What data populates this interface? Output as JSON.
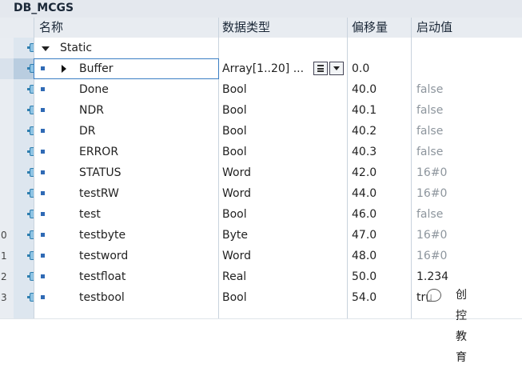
{
  "title": "DB_MCGS",
  "columns": {
    "name": "名称",
    "type": "数据类型",
    "offset": "偏移量",
    "start": "启动值"
  },
  "static_row": {
    "name": "Static"
  },
  "rows": [
    {
      "num": "",
      "name": "Buffer",
      "type": "Array[1..20] ...",
      "offset": "0.0",
      "start": "",
      "expand": true,
      "selected": true
    },
    {
      "num": "",
      "name": "Done",
      "type": "Bool",
      "offset": "40.0",
      "start": "false"
    },
    {
      "num": "",
      "name": "NDR",
      "type": "Bool",
      "offset": "40.1",
      "start": "false"
    },
    {
      "num": "",
      "name": "DR",
      "type": "Bool",
      "offset": "40.2",
      "start": "false"
    },
    {
      "num": "",
      "name": "ERROR",
      "type": "Bool",
      "offset": "40.3",
      "start": "false"
    },
    {
      "num": "",
      "name": "STATUS",
      "type": "Word",
      "offset": "42.0",
      "start": "16#0"
    },
    {
      "num": "",
      "name": "testRW",
      "type": "Word",
      "offset": "44.0",
      "start": "16#0"
    },
    {
      "num": "",
      "name": "test",
      "type": "Bool",
      "offset": "46.0",
      "start": "false"
    },
    {
      "num": "0",
      "name": "testbyte",
      "type": "Byte",
      "offset": "47.0",
      "start": "16#0"
    },
    {
      "num": "1",
      "name": "testword",
      "type": "Word",
      "offset": "48.0",
      "start": "16#0"
    },
    {
      "num": "2",
      "name": "testfloat",
      "type": "Real",
      "offset": "50.0",
      "start": "1.234"
    },
    {
      "num": "3",
      "name": "testbool",
      "type": "Bool",
      "offset": "54.0",
      "start": "tru"
    }
  ],
  "watermark": "创控教育",
  "icons": {
    "interface": "db-interface-icon",
    "bullet": "variable-bullet-icon"
  }
}
